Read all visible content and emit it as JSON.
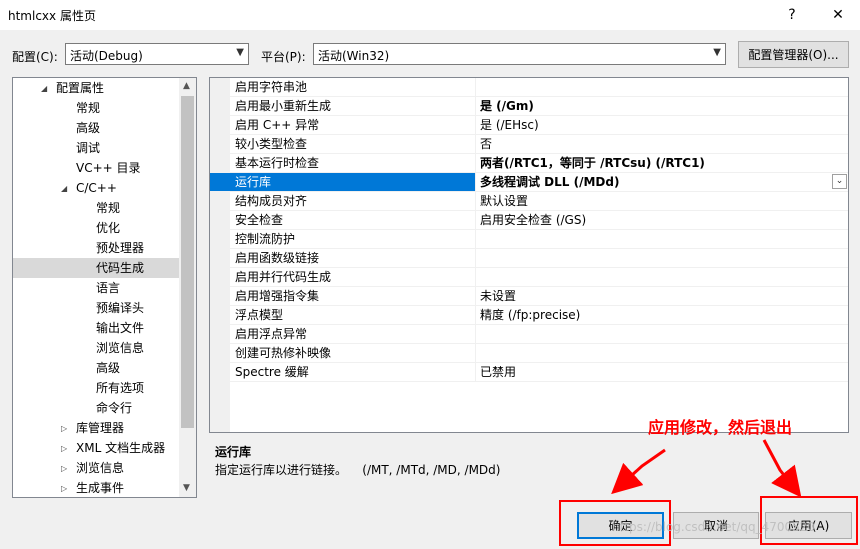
{
  "window": {
    "title": "htmlcxx 属性页",
    "help_glyph": "?",
    "close_glyph": "✕"
  },
  "toolbar": {
    "config_label": "配置(C):",
    "config_value": "活动(Debug)",
    "platform_label": "平台(P):",
    "platform_value": "活动(Win32)",
    "config_manager_label": "配置管理器(O)..."
  },
  "tree": {
    "items": [
      {
        "label": "配置属性",
        "level": 0,
        "expanded": true,
        "arrow": "◢"
      },
      {
        "label": "常规",
        "level": 1
      },
      {
        "label": "高级",
        "level": 1
      },
      {
        "label": "调试",
        "level": 1
      },
      {
        "label": "VC++ 目录",
        "level": 1
      },
      {
        "label": "C/C++",
        "level": 1,
        "expanded": true,
        "arrow": "◢"
      },
      {
        "label": "常规",
        "level": 2
      },
      {
        "label": "优化",
        "level": 2
      },
      {
        "label": "预处理器",
        "level": 2
      },
      {
        "label": "代码生成",
        "level": 2,
        "selected": true
      },
      {
        "label": "语言",
        "level": 2
      },
      {
        "label": "预编译头",
        "level": 2
      },
      {
        "label": "输出文件",
        "level": 2
      },
      {
        "label": "浏览信息",
        "level": 2
      },
      {
        "label": "高级",
        "level": 2
      },
      {
        "label": "所有选项",
        "level": 2
      },
      {
        "label": "命令行",
        "level": 2
      },
      {
        "label": "库管理器",
        "level": 1,
        "arrow": "▷"
      },
      {
        "label": "XML 文档生成器",
        "level": 1,
        "arrow": "▷"
      },
      {
        "label": "浏览信息",
        "level": 1,
        "arrow": "▷"
      },
      {
        "label": "生成事件",
        "level": 1,
        "arrow": "▷"
      }
    ]
  },
  "properties": [
    {
      "name": "启用字符串池",
      "value": "",
      "bold": false
    },
    {
      "name": "启用最小重新生成",
      "value": "是 (/Gm)",
      "bold": true
    },
    {
      "name": "启用 C++ 异常",
      "value": "是 (/EHsc)",
      "bold": false
    },
    {
      "name": "较小类型检查",
      "value": "否",
      "bold": false
    },
    {
      "name": "基本运行时检查",
      "value": "两者(/RTC1，等同于 /RTCsu) (/RTC1)",
      "bold": true
    },
    {
      "name": "运行库",
      "value": "多线程调试 DLL (/MDd)",
      "bold": true,
      "selected": true
    },
    {
      "name": "结构成员对齐",
      "value": "默认设置",
      "bold": false
    },
    {
      "name": "安全检查",
      "value": "启用安全检查 (/GS)",
      "bold": false
    },
    {
      "name": "控制流防护",
      "value": "",
      "bold": false
    },
    {
      "name": "启用函数级链接",
      "value": "",
      "bold": false
    },
    {
      "name": "启用并行代码生成",
      "value": "",
      "bold": false
    },
    {
      "name": "启用增强指令集",
      "value": "未设置",
      "bold": false
    },
    {
      "name": "浮点模型",
      "value": "精度 (/fp:precise)",
      "bold": false
    },
    {
      "name": "启用浮点异常",
      "value": "",
      "bold": false
    },
    {
      "name": "创建可热修补映像",
      "value": "",
      "bold": false
    },
    {
      "name": "Spectre 缓解",
      "value": "已禁用",
      "bold": false
    }
  ],
  "description": {
    "title": "运行库",
    "text": "指定运行库以进行链接。    (/MT, /MTd, /MD, /MDd)"
  },
  "annotation": {
    "text": "应用修改，然后退出",
    "color": "#ff0000"
  },
  "buttons": {
    "ok": "确定",
    "cancel": "取消",
    "apply": "应用(A)"
  },
  "watermark": "https://blog.csdn.net/qq_4700520",
  "colors": {
    "selection": "#0078d7",
    "tree_selection": "#d9d9d9",
    "annotation": "#ff0000"
  }
}
